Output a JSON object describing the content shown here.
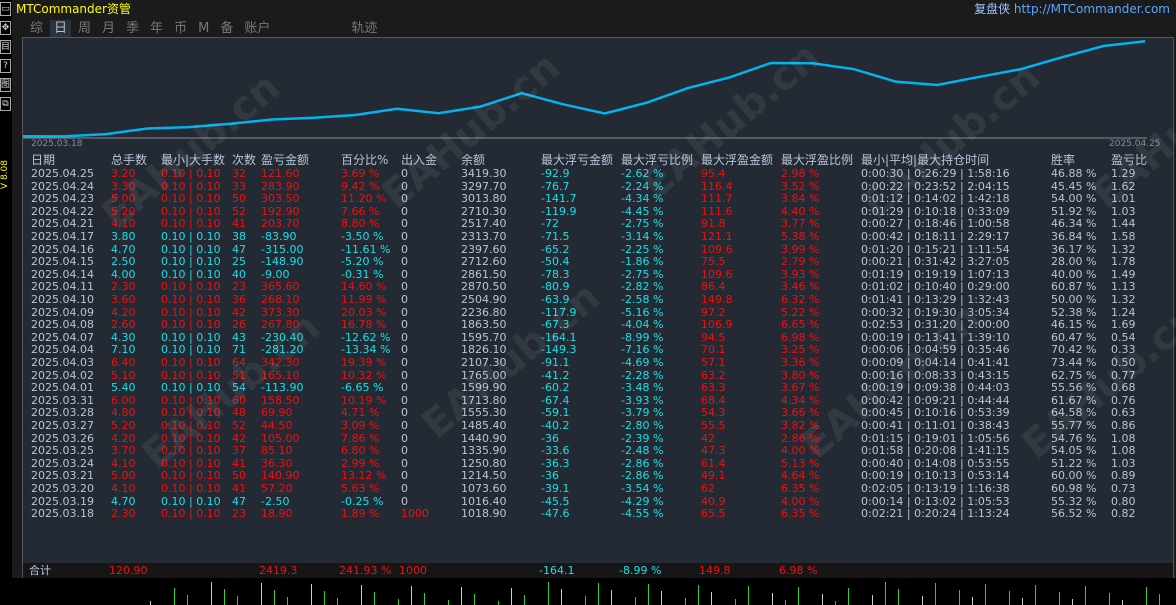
{
  "app": {
    "title": "MTCommander资管",
    "brand_name": "复盘侠",
    "brand_url": "http://MTCommander.com",
    "version": "V 8.08"
  },
  "toolbar_icons": [
    "window-icon",
    "move-icon",
    "report-icon",
    "help-icon",
    "chart-icon",
    "restore-icon"
  ],
  "toolbar_glyphs": [
    "▭",
    "✥",
    "目",
    "?",
    "图",
    "⧉"
  ],
  "tabs": [
    "综",
    "日",
    "周",
    "月",
    "季",
    "年",
    "币",
    "M",
    "备",
    "账户",
    "轨迹"
  ],
  "active_tab": "日",
  "chart": {
    "start_label": "2025.03.18",
    "end_label": "2025.04.25",
    "line_color": "#00b4f0"
  },
  "headers": [
    "日期",
    "总手数",
    "最小|大手数",
    "次数",
    "盈亏金额",
    "百分比%",
    "出入金",
    "余额",
    "最大浮亏金额",
    "最大浮亏比例",
    "最大浮盈金额",
    "最大浮盈比例",
    "最小|平均|最大持仓时间",
    "胜率",
    "盈亏比"
  ],
  "rows": [
    [
      "2025.04.25",
      "3.20",
      "0.10 | 0.10",
      "32",
      "121.60",
      "3.69 %",
      "0",
      "3419.30",
      "-92.9",
      "-2.62 %",
      "95.4",
      "2.98 %",
      "0:00:30 | 0:26:29 | 1:58:16",
      "46.88 %",
      "1.29"
    ],
    [
      "2025.04.24",
      "3.30",
      "0.10 | 0.10",
      "33",
      "283.90",
      "9.42 %",
      "0",
      "3297.70",
      "-76.7",
      "-2.24 %",
      "116.4",
      "3.52 %",
      "0:00:22 | 0:23:52 | 2:04:15",
      "45.45 %",
      "1.62"
    ],
    [
      "2025.04.23",
      "5.00",
      "0.10 | 0.10",
      "50",
      "303.50",
      "11.20 %",
      "0",
      "3013.80",
      "-141.7",
      "-4.34 %",
      "111.7",
      "3.84 %",
      "0:01:12 | 0:14:02 | 1:42:18",
      "54.00 %",
      "1.01"
    ],
    [
      "2025.04.22",
      "5.20",
      "0.10 | 0.10",
      "52",
      "192.90",
      "7.66 %",
      "0",
      "2710.30",
      "-119.9",
      "-4.45 %",
      "111.6",
      "4.40 %",
      "0:01:29 | 0:10:18 | 0:33:09",
      "51.92 %",
      "1.03"
    ],
    [
      "2025.04.21",
      "4.10",
      "0.10 | 0.10",
      "41",
      "203.70",
      "8.80 %",
      "0",
      "2517.40",
      "-72",
      "-2.75 %",
      "91.8",
      "3.77 %",
      "0:00:27 | 0:18:46 | 1:00:58",
      "46.34 %",
      "1.44"
    ],
    [
      "2025.04.17",
      "3.80",
      "0.10 | 0.10",
      "38",
      "-83.90",
      "-3.50 %",
      "0",
      "2313.70",
      "-71.5",
      "-3.14 %",
      "121.1",
      "5.38 %",
      "0:00:42 | 0:18:11 | 2:29:17",
      "36.84 %",
      "1.58"
    ],
    [
      "2025.04.16",
      "4.70",
      "0.10 | 0.10",
      "47",
      "-315.00",
      "-11.61 %",
      "0",
      "2397.60",
      "-65.2",
      "-2.25 %",
      "109.6",
      "3.99 %",
      "0:01:20 | 0:15:21 | 1:11:54",
      "36.17 %",
      "1.32"
    ],
    [
      "2025.04.15",
      "2.50",
      "0.10 | 0.10",
      "25",
      "-148.90",
      "-5.20 %",
      "0",
      "2712.60",
      "-50.4",
      "-1.86 %",
      "75.5",
      "2.79 %",
      "0:00:21 | 0:31:42 | 3:27:05",
      "28.00 %",
      "1.78"
    ],
    [
      "2025.04.14",
      "4.00",
      "0.10 | 0.10",
      "40",
      "-9.00",
      "-0.31 %",
      "0",
      "2861.50",
      "-78.3",
      "-2.75 %",
      "109.6",
      "3.93 %",
      "0:01:19 | 0:19:19 | 1:07:13",
      "40.00 %",
      "1.49"
    ],
    [
      "2025.04.11",
      "2.30",
      "0.10 | 0.10",
      "23",
      "365.60",
      "14.60 %",
      "0",
      "2870.50",
      "-80.9",
      "-2.82 %",
      "86.4",
      "3.46 %",
      "0:01:02 | 0:10:40 | 0:29:00",
      "60.87 %",
      "1.13"
    ],
    [
      "2025.04.10",
      "3.60",
      "0.10 | 0.10",
      "36",
      "268.10",
      "11.99 %",
      "0",
      "2504.90",
      "-63.9",
      "-2.58 %",
      "149.8",
      "6.32 %",
      "0:01:41 | 0:13:29 | 1:32:43",
      "50.00 %",
      "1.32"
    ],
    [
      "2025.04.09",
      "4.20",
      "0.10 | 0.10",
      "42",
      "373.30",
      "20.03 %",
      "0",
      "2236.80",
      "-117.9",
      "-5.16 %",
      "97.2",
      "5.22 %",
      "0:00:32 | 0:19:30 | 3:05:34",
      "52.38 %",
      "1.24"
    ],
    [
      "2025.04.08",
      "2.60",
      "0.10 | 0.10",
      "26",
      "267.80",
      "16.78 %",
      "0",
      "1863.50",
      "-67.3",
      "-4.04 %",
      "106.9",
      "6.65 %",
      "0:02:53 | 0:31:20 | 2:00:00",
      "46.15 %",
      "1.69"
    ],
    [
      "2025.04.07",
      "4.30",
      "0.10 | 0.10",
      "43",
      "-230.40",
      "-12.62 %",
      "0",
      "1595.70",
      "-164.1",
      "-8.99 %",
      "94.5",
      "6.98 %",
      "0:00:19 | 0:13:41 | 1:39:10",
      "60.47 %",
      "0.54"
    ],
    [
      "2025.04.04",
      "7.10",
      "0.10 | 0.10",
      "71",
      "-281.20",
      "-13.34 %",
      "0",
      "1826.10",
      "-149.3",
      "-7.16 %",
      "70.1",
      "3.25 %",
      "0:00:06 | 0:04:59 | 0:35:46",
      "70.42 %",
      "0.33"
    ],
    [
      "2025.04.03",
      "6.40",
      "0.10 | 0.10",
      "64",
      "342.30",
      "19.39 %",
      "0",
      "2107.30",
      "-91.1",
      "-4.69 %",
      "57.1",
      "3.36 %",
      "0:00:09 | 0:04:14 | 0:41:41",
      "73.44 %",
      "0.50"
    ],
    [
      "2025.04.02",
      "5.10",
      "0.10 | 0.10",
      "51",
      "165.10",
      "10.32 %",
      "0",
      "1765.00",
      "-41.2",
      "-2.28 %",
      "63.2",
      "3.80 %",
      "0:00:16 | 0:08:33 | 0:43:15",
      "62.75 %",
      "0.77"
    ],
    [
      "2025.04.01",
      "5.40",
      "0.10 | 0.10",
      "54",
      "-113.90",
      "-6.65 %",
      "0",
      "1599.90",
      "-60.2",
      "-3.48 %",
      "63.3",
      "3.67 %",
      "0:00:19 | 0:09:38 | 0:44:03",
      "55.56 %",
      "0.68"
    ],
    [
      "2025.03.31",
      "6.00",
      "0.10 | 0.10",
      "60",
      "158.50",
      "10.19 %",
      "0",
      "1713.80",
      "-67.4",
      "-3.93 %",
      "68.4",
      "4.34 %",
      "0:00:42 | 0:09:21 | 0:44:44",
      "61.67 %",
      "0.76"
    ],
    [
      "2025.03.28",
      "4.80",
      "0.10 | 0.10",
      "48",
      "69.90",
      "4.71 %",
      "0",
      "1555.30",
      "-59.1",
      "-3.79 %",
      "54.3",
      "3.66 %",
      "0:00:45 | 0:10:16 | 0:53:39",
      "64.58 %",
      "0.63"
    ],
    [
      "2025.03.27",
      "5.20",
      "0.10 | 0.10",
      "52",
      "44.50",
      "3.09 %",
      "0",
      "1485.40",
      "-40.2",
      "-2.80 %",
      "55.5",
      "3.82 %",
      "0:00:41 | 0:11:01 | 0:38:43",
      "55.77 %",
      "0.86"
    ],
    [
      "2025.03.26",
      "4.20",
      "0.10 | 0.10",
      "42",
      "105.00",
      "7.86 %",
      "0",
      "1440.90",
      "-36",
      "-2.39 %",
      "42",
      "2.86 %",
      "0:01:15 | 0:19:01 | 1:05:56",
      "54.76 %",
      "1.08"
    ],
    [
      "2025.03.25",
      "3.70",
      "0.10 | 0.10",
      "37",
      "85.10",
      "6.80 %",
      "0",
      "1335.90",
      "-33.6",
      "-2.48 %",
      "47.3",
      "4.00 %",
      "0:01:58 | 0:20:08 | 1:41:15",
      "54.05 %",
      "1.08"
    ],
    [
      "2025.03.24",
      "4.10",
      "0.10 | 0.10",
      "41",
      "36.30",
      "2.99 %",
      "0",
      "1250.80",
      "-36.3",
      "-2.86 %",
      "61.4",
      "5.13 %",
      "0:00:40 | 0:14:08 | 0:53:55",
      "51.22 %",
      "1.03"
    ],
    [
      "2025.03.21",
      "5.00",
      "0.10 | 0.10",
      "50",
      "140.90",
      "13.12 %",
      "0",
      "1214.50",
      "-36",
      "-2.86 %",
      "49.1",
      "4.64 %",
      "0:00:19 | 0:10:13 | 0:53:14",
      "60.00 %",
      "0.89"
    ],
    [
      "2025.03.20",
      "4.10",
      "0.10 | 0.10",
      "41",
      "57.20",
      "5.63 %",
      "0",
      "1073.60",
      "-39.1",
      "-3.54 %",
      "62",
      "6.35 %",
      "0:02:05 | 0:13:19 | 1:16:38",
      "60.98 %",
      "0.73"
    ],
    [
      "2025.03.19",
      "4.70",
      "0.10 | 0.10",
      "47",
      "-2.50",
      "-0.25 %",
      "0",
      "1016.40",
      "-45.5",
      "-4.29 %",
      "40.9",
      "4.00 %",
      "0:00:14 | 0:13:02 | 1:05:53",
      "55.32 %",
      "0.80"
    ],
    [
      "2025.03.18",
      "2.30",
      "0.10 | 0.10",
      "23",
      "18.90",
      "1.89 %",
      "1000",
      "1018.90",
      "-47.6",
      "-4.55 %",
      "65.5",
      "6.35 %",
      "0:02:21 | 0:20:24 | 1:13:24",
      "56.52 %",
      "0.82"
    ]
  ],
  "total": {
    "label": "合计",
    "lots": "120.90",
    "pnl": "2419.3",
    "pct": "241.93 %",
    "deposit": "1000",
    "max_float_loss": "-164.1",
    "max_float_loss_pct": "-8.99 %",
    "max_float_profit": "149.8",
    "max_float_profit_pct": "6.98 %"
  },
  "colors": {
    "profit": "#f01010",
    "loss": "#18e0e8",
    "text": "#b8c4d8",
    "title": "#ffff00"
  },
  "watermark": "EAHub.cn"
}
